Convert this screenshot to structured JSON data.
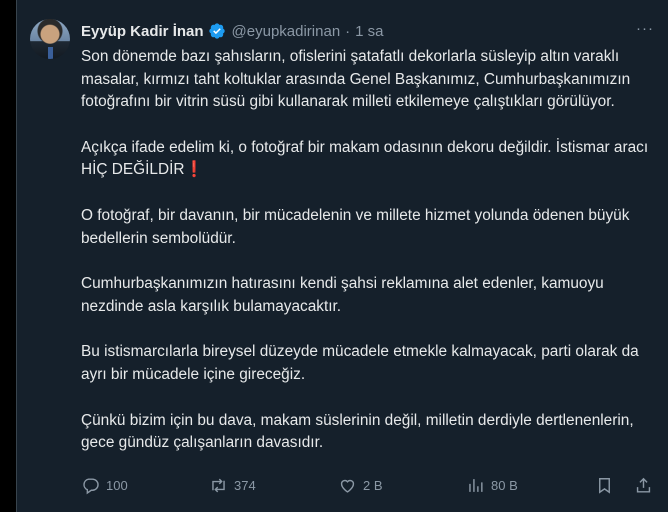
{
  "author": {
    "name": "Eyyüp Kadir İnan",
    "handle": "@eyupkadirinan",
    "separator": "·",
    "time": "1 sa",
    "verified": true
  },
  "more_menu": "···",
  "paragraphs": [
    "Son dönemde bazı şahısların, ofislerini şatafatlı dekorlarla süsleyip altın varaklı masalar, kırmızı taht koltuklar arasında Genel Başkanımız, Cumhurbaşkanımızın fotoğrafını bir vitrin süsü gibi kullanarak milleti etkilemeye çalıştıkları görülüyor.",
    "Açıkça ifade edelim ki, o fotoğraf bir makam odasının dekoru değildir. İstismar aracı HİÇ DEĞİLDİR",
    "O fotoğraf, bir davanın, bir mücadelenin ve millete hizmet yolunda ödenen büyük bedellerin sembolüdür.",
    "Cumhurbaşkanımızın hatırasını kendi şahsi reklamına alet edenler, kamuoyu nezdinde asla karşılık bulamayacaktır.",
    "Bu istismarcılarla bireysel düzeyde mücadele etmekle kalmayacak, parti olarak da ayrı bir mücadele içine gireceğiz.",
    "Çünkü bizim için bu dava, makam süslerinin değil, milletin derdiyle dertlenenlerin, gece gündüz çalışanların davasıdır."
  ],
  "emoji": "❗",
  "actions": {
    "replies": "100",
    "reposts": "374",
    "likes": "2 B",
    "views": "80 B"
  },
  "icons": {
    "reply": "reply-icon",
    "repost": "repost-icon",
    "like": "heart-icon",
    "views": "views-icon",
    "bookmark": "bookmark-icon",
    "share": "share-icon"
  },
  "colors": {
    "background": "#15202b",
    "text": "#e7e9ea",
    "muted": "#8b98a5",
    "verified": "#1d9bf0",
    "emoji": "#e0245e"
  }
}
